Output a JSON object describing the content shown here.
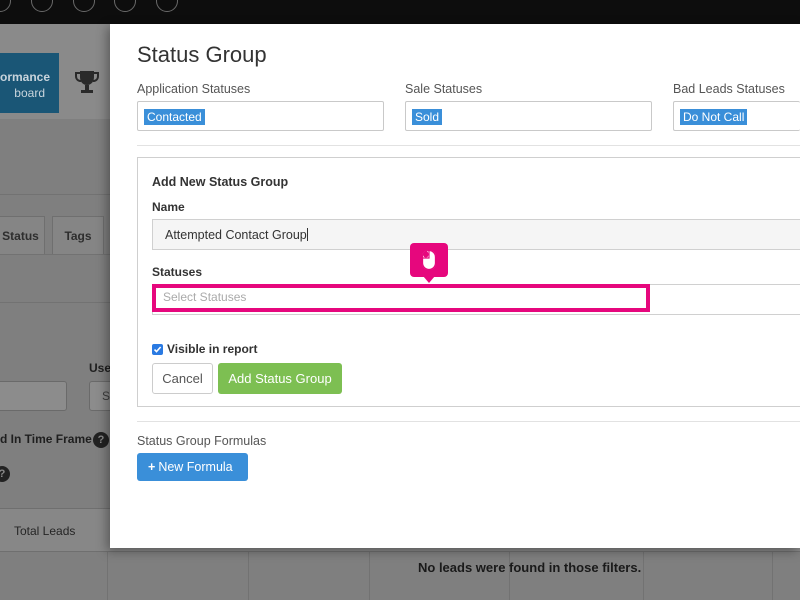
{
  "background": {
    "performance_tile": {
      "line1": "ormance",
      "line2": "board"
    },
    "tabs": [
      {
        "label": "Status"
      },
      {
        "label": "Tags"
      }
    ],
    "user_label": "Use",
    "input_placeholder_fragment": "Se",
    "timeframe_label": "d In Time Frame",
    "help_glyph": "?",
    "table": {
      "col_total_leads": "Total Leads"
    },
    "empty_message": "No leads were found in those filters."
  },
  "modal": {
    "title": "Status Group",
    "status_columns": [
      {
        "label": "Application Statuses",
        "chip": "Contacted"
      },
      {
        "label": "Sale Statuses",
        "chip": "Sold"
      },
      {
        "label": "Bad Leads Statuses",
        "chip": "Do Not Call"
      }
    ],
    "add_group": {
      "title": "Add New Status Group",
      "name_label": "Name",
      "name_value": "Attempted Contact Group",
      "statuses_label": "Statuses",
      "statuses_placeholder": "Select Statuses",
      "visible_label": "Visible in report",
      "visible_checked": true,
      "cancel_label": "Cancel",
      "submit_label": "Add Status Group"
    },
    "formulas": {
      "label": "Status Group Formulas",
      "new_button_icon": "+",
      "new_button_label": "New Formula"
    }
  },
  "colors": {
    "highlight": "#e6077d",
    "primary": "#3a8fd9",
    "success": "#7dbf52"
  },
  "icons": [
    "mouse-icon",
    "trophy-icon",
    "check-icon",
    "plus-icon",
    "help-icon"
  ]
}
